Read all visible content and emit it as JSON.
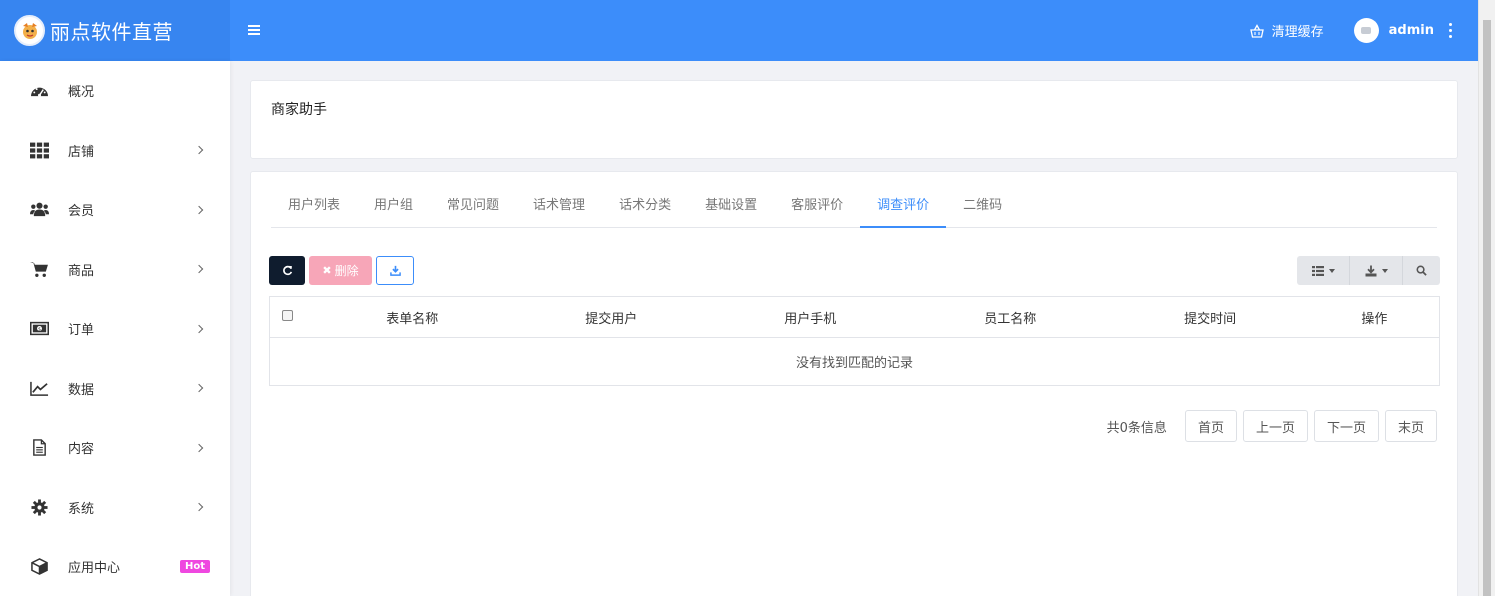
{
  "header": {
    "brand_name": "丽点软件直营",
    "clear_cache_label": "清理缓存",
    "username": "admin"
  },
  "sidebar": {
    "items": [
      {
        "label": "概况",
        "icon": "dashboard-icon",
        "has_submenu": false
      },
      {
        "label": "店铺",
        "icon": "grid-icon",
        "has_submenu": true
      },
      {
        "label": "会员",
        "icon": "users-icon",
        "has_submenu": true
      },
      {
        "label": "商品",
        "icon": "cart-icon",
        "has_submenu": true
      },
      {
        "label": "订单",
        "icon": "money-icon",
        "has_submenu": true
      },
      {
        "label": "数据",
        "icon": "chart-line-icon",
        "has_submenu": true
      },
      {
        "label": "内容",
        "icon": "document-icon",
        "has_submenu": true
      },
      {
        "label": "系统",
        "icon": "gear-icon",
        "has_submenu": true
      },
      {
        "label": "应用中心",
        "icon": "cube-icon",
        "has_submenu": false,
        "badge": "Hot"
      }
    ]
  },
  "page_title": "商家助手",
  "tabs": [
    {
      "label": "用户列表",
      "active": false
    },
    {
      "label": "用户组",
      "active": false
    },
    {
      "label": "常见问题",
      "active": false
    },
    {
      "label": "话术管理",
      "active": false
    },
    {
      "label": "话术分类",
      "active": false
    },
    {
      "label": "基础设置",
      "active": false
    },
    {
      "label": "客服评价",
      "active": false
    },
    {
      "label": "调查评价",
      "active": true
    },
    {
      "label": "二维码",
      "active": false
    }
  ],
  "toolbar": {
    "delete_label": "删除"
  },
  "table": {
    "columns": [
      "表单名称",
      "提交用户",
      "用户手机",
      "员工名称",
      "提交时间",
      "操作"
    ],
    "empty_text": "没有找到匹配的记录"
  },
  "pagination": {
    "total_text": "共0条信息",
    "first": "首页",
    "prev": "上一页",
    "next": "下一页",
    "last": "末页"
  },
  "colors": {
    "header_bg": "#3c8dfa",
    "accent": "#3c8dfa",
    "refresh_btn": "#0f1c2e",
    "delete_btn": "#f7a6b8",
    "hot_badge": "#ef48e0"
  }
}
